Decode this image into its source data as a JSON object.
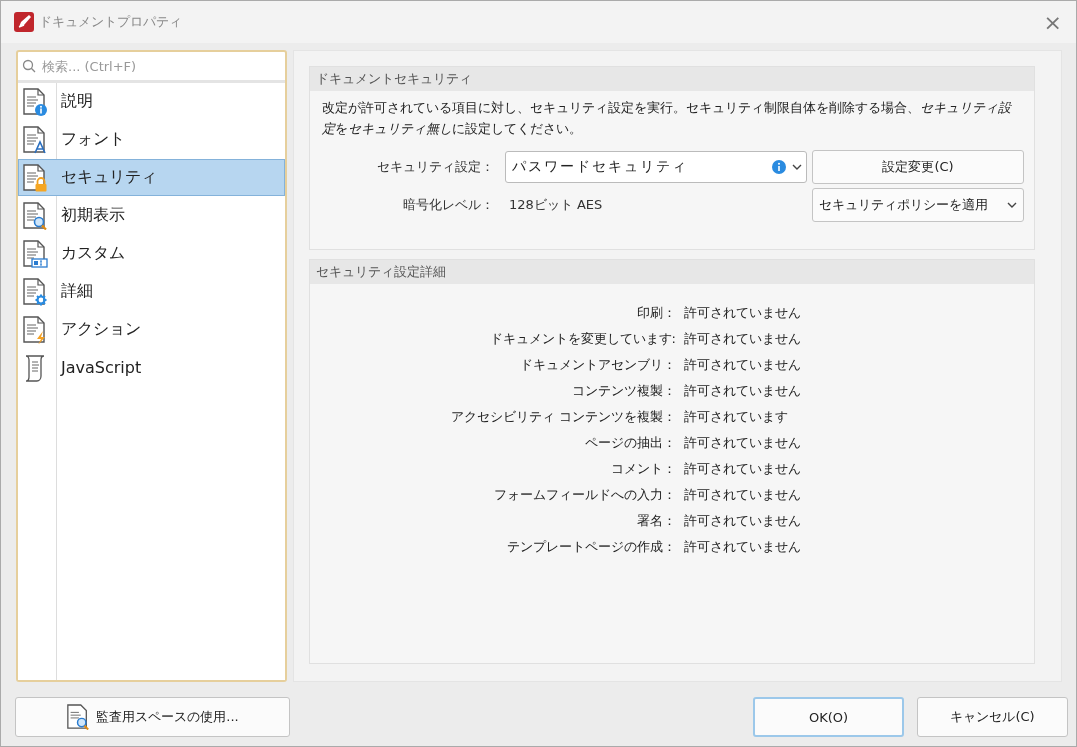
{
  "window": {
    "title": "ドキュメントプロパティ",
    "close": "×"
  },
  "sidebar": {
    "search": {
      "placeholder": "検索... (Ctrl+F)"
    },
    "items": [
      {
        "label": "説明",
        "selected": false
      },
      {
        "label": "フォント",
        "selected": false
      },
      {
        "label": "セキュリティ",
        "selected": true
      },
      {
        "label": "初期表示",
        "selected": false
      },
      {
        "label": "カスタム",
        "selected": false
      },
      {
        "label": "詳細",
        "selected": false
      },
      {
        "label": "アクション",
        "selected": false
      },
      {
        "label": "JavaScript",
        "selected": false
      }
    ]
  },
  "document_security": {
    "title": "ドキュメントセキュリティ",
    "description": [
      {
        "text": "改定が許可されている項目に対し、セキュリティ設定を実行。セキュリティ制限自体を削除する場合、",
        "italic": false
      },
      {
        "text": "セキュリティ設定",
        "italic": true
      },
      {
        "text": "を",
        "italic": false
      },
      {
        "text": "セキュリティ無し",
        "italic": true
      },
      {
        "text": "に設定してください。",
        "italic": false
      }
    ],
    "security_setting": {
      "label": "セキュリティ設定：",
      "value": "パスワードセキュリティ"
    },
    "encryption": {
      "label": "暗号化レベル：",
      "value": "128ビット AES"
    },
    "change_button": "設定変更(C)",
    "policy_button": "セキュリティポリシーを適用"
  },
  "security_details": {
    "title": "セキュリティ設定詳細",
    "rows": [
      {
        "label": "印刷：",
        "value": "許可されていません"
      },
      {
        "label": "ドキュメントを変更しています:",
        "value": "許可されていません"
      },
      {
        "label": "ドキュメントアセンブリ：",
        "value": "許可されていません"
      },
      {
        "label": "コンテンツ複製：",
        "value": "許可されていません"
      },
      {
        "label": "アクセシビリティ コンテンツを複製：",
        "value": "許可されています"
      },
      {
        "label": "ページの抽出：",
        "value": "許可されていません"
      },
      {
        "label": "コメント：",
        "value": "許可されていません"
      },
      {
        "label": "フォームフィールドへの入力：",
        "value": "許可されていません"
      },
      {
        "label": "署名：",
        "value": "許可されていません"
      },
      {
        "label": "テンプレートページの作成：",
        "value": "許可されていません"
      }
    ]
  },
  "footer": {
    "audit_button": "監査用スペースの使用...",
    "ok_button": "OK(O)",
    "cancel_button": "キャンセル(C)"
  }
}
